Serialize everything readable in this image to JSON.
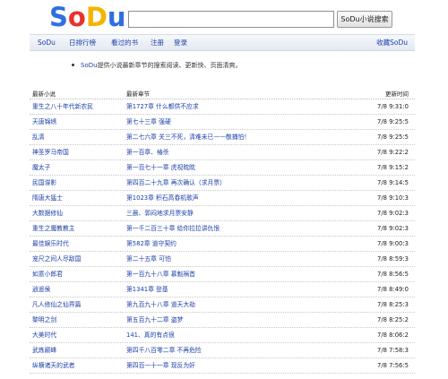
{
  "logo": {
    "letters": [
      {
        "ch": "S",
        "color": "#2f6fe0"
      },
      {
        "ch": "o",
        "color": "#e8322b"
      },
      {
        "ch": "D",
        "color": "#f5b400"
      },
      {
        "ch": "u",
        "color": "#2f6fe0"
      }
    ]
  },
  "search": {
    "value": "",
    "button_label": "SoDu小说搜索"
  },
  "nav": {
    "items": [
      "SoDu",
      "日排行榜",
      "看过的书",
      "注册",
      "登录"
    ],
    "right": "收藏SoDu"
  },
  "notice": {
    "link": "SoDu",
    "text": "提供小说最新章节的搜索阅读、更新快、页面清爽。"
  },
  "table": {
    "headers": {
      "title": "最新小说",
      "chapter": "最新章节",
      "time": "更新时间"
    },
    "rows": [
      {
        "title": "重生之八十年代新农民",
        "chapter": "第1727章 什么都供不应求",
        "time": "7/8 9:31:0"
      },
      {
        "title": "天唐锦绣",
        "chapter": "第七十三章 强硬",
        "time": "7/8 9:25:5"
      },
      {
        "title": "乱清",
        "chapter": "第二七六章 关三不死，清难未已——敬捕怕！",
        "time": "7/8 9:25:5"
      },
      {
        "title": "神圣罗马帝国",
        "chapter": "第一百章、椿杀",
        "time": "7/8 9:22:2"
      },
      {
        "title": "魔太子",
        "chapter": "第一百七十一章 虎视眈眈",
        "time": "7/8 9:15:2"
      },
      {
        "title": "民国谍影",
        "chapter": "第四百二十九章 再次确认（求月票）",
        "time": "7/8 9:14:5"
      },
      {
        "title": "隋唐大猛士",
        "chapter": "第1023章 积石高春机歌声",
        "time": "7/8 9:10:3"
      },
      {
        "title": "大数据修仙",
        "chapter": "三晨、郭闷地求月票安静",
        "time": "7/8 9:02:3"
      },
      {
        "title": "重生之魔教教主",
        "chapter": "第一千二百三十章 给你拉拉讲仇恨",
        "time": "7/8 9:02:3"
      },
      {
        "title": "最佳娱乐时代",
        "chapter": "第582章 道守契约",
        "time": "7/8 9:00:3"
      },
      {
        "title": "宠尺之间人尽敌国",
        "chapter": "第二十五章 可怕",
        "time": "7/8 8:59:3"
      },
      {
        "title": "如意小郎君",
        "chapter": "第一百九十八章 慕魁祸首",
        "time": "7/8 8:56:5"
      },
      {
        "title": "逍遥侯",
        "chapter": "第1341章 登基",
        "time": "7/8 8:49:0"
      },
      {
        "title": "凡人修仙之仙界篇",
        "chapter": "第九百九十八章 道天大劫",
        "time": "7/8 8:25:3"
      },
      {
        "title": "黎明之剑",
        "chapter": "第五百九十二章 盗梦",
        "time": "7/8 8:25:2"
      },
      {
        "title": "大美时代",
        "chapter": "141、真的有点很",
        "time": "7/8 8:06:2"
      },
      {
        "title": "武炼巅峰",
        "chapter": "第四千八百零二章 不再危险",
        "time": "7/8 7:58:3"
      },
      {
        "title": "纵横诸天的武者",
        "chapter": "第四百一十一章 现反为奸",
        "time": "7/8 7:56:5"
      }
    ]
  }
}
